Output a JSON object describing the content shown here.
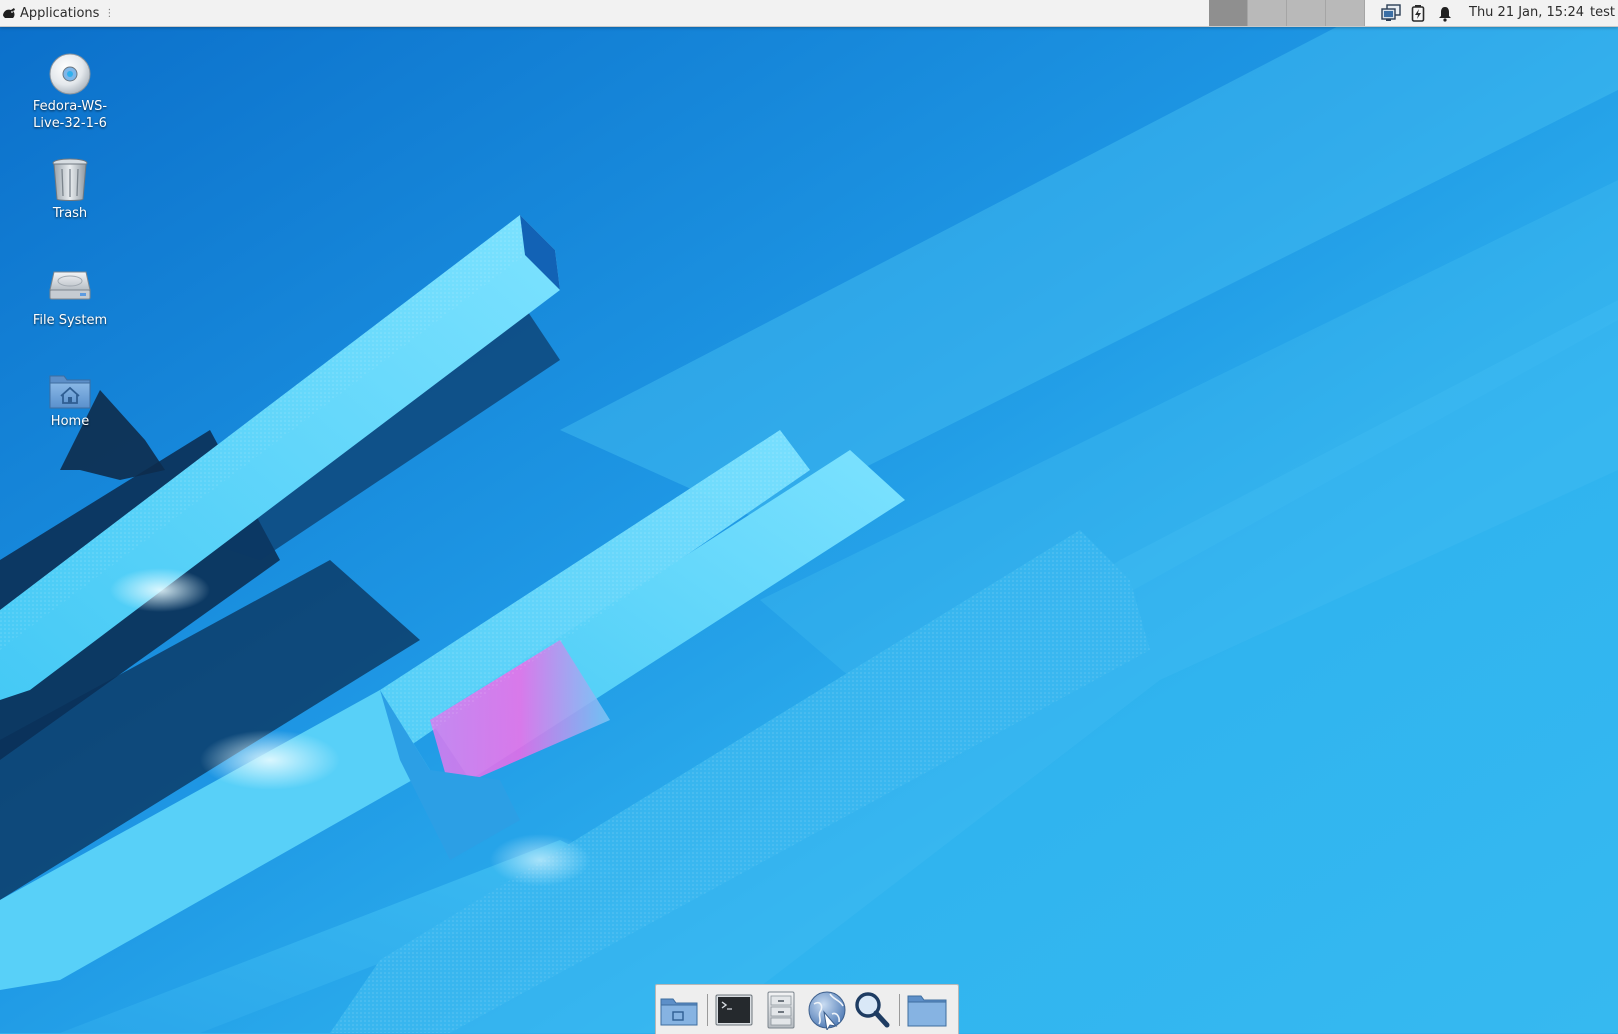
{
  "panel": {
    "applications_label": "Applications",
    "separator_glyph": "⋮",
    "workspaces": [
      "1",
      "2",
      "3",
      "4"
    ],
    "active_workspace": 0,
    "clock": "Thu 21 Jan, 15:24",
    "user": "test",
    "tray": [
      "network-icon",
      "battery-charging-icon",
      "notification-bell-icon"
    ]
  },
  "desktop": {
    "icons": [
      {
        "label": "Fedora-WS-Live-32-1-6",
        "icon": "optical-disc-icon"
      },
      {
        "label": "Trash",
        "icon": "trash-icon"
      },
      {
        "label": "File System",
        "icon": "hard-drive-icon"
      },
      {
        "label": "Home",
        "icon": "home-folder-icon"
      }
    ]
  },
  "dock": {
    "items": [
      "show-desktop-icon",
      "terminal-icon",
      "file-manager-icon",
      "web-browser-icon",
      "app-finder-icon",
      "folder-icon"
    ]
  },
  "colors": {
    "wallpaper_base": "#2eb0ee",
    "wallpaper_dark": "#0a66bf",
    "panel_bg": "#f2f2f2"
  }
}
